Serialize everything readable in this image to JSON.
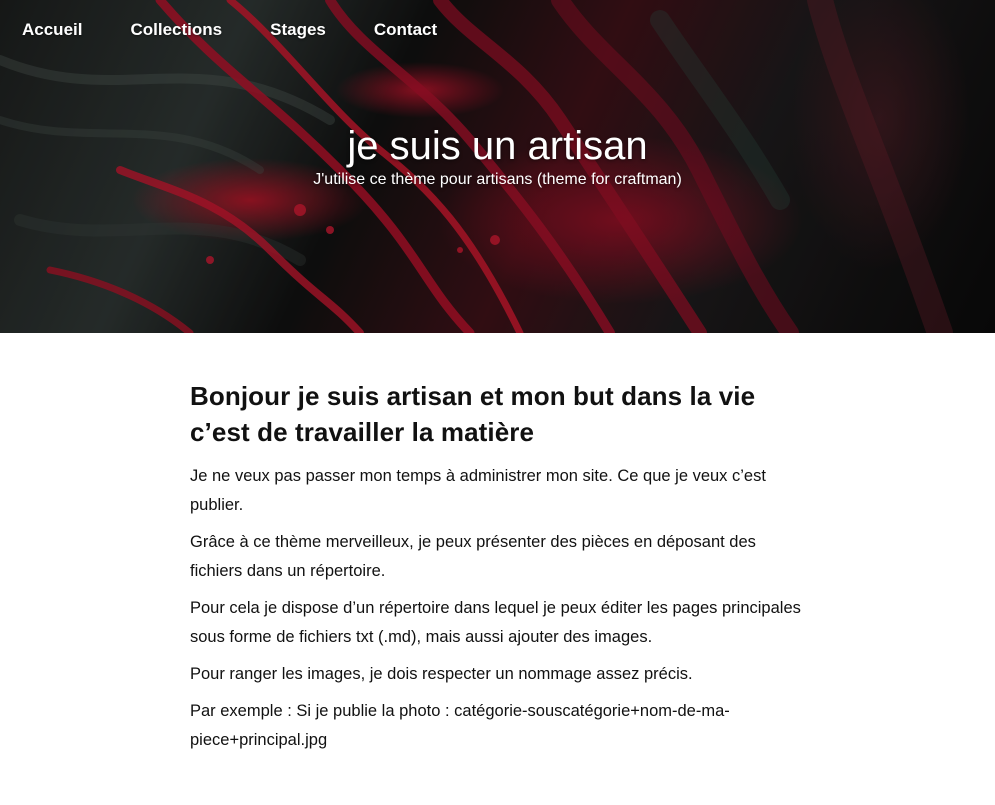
{
  "nav": {
    "items": [
      {
        "label": "Accueil"
      },
      {
        "label": "Collections"
      },
      {
        "label": "Stages"
      },
      {
        "label": "Contact"
      }
    ]
  },
  "hero": {
    "title": "je suis un artisan",
    "subtitle": "J'utilise ce thème pour artisans (theme for craftman)"
  },
  "main": {
    "heading": "Bonjour je suis artisan et mon but dans la vie c’est de travailler la matière",
    "paragraphs": [
      "Je ne veux pas passer mon temps à administrer mon site. Ce que je veux c’est publier.",
      "Grâce à ce thème merveilleux, je peux présenter des pièces en déposant des fichiers dans un répertoire.",
      "Pour cela je dispose d’un répertoire dans lequel je peux éditer les pages principales sous forme de fichiers txt (.md), mais aussi ajouter des images.",
      "Pour ranger les images, je dois respecter un nommage assez précis.",
      "Par exemple : Si je publie la photo : catégorie-souscatégorie+nom-de-ma-piece+principal.jpg"
    ]
  },
  "colors": {
    "hero_red": "#c0142a",
    "hero_dark": "#141616",
    "text": "#111111",
    "nav_text": "#ffffff"
  }
}
